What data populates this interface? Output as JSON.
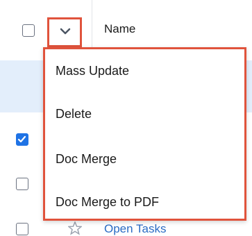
{
  "header": {
    "name_column_label": "Name"
  },
  "mass_actions_menu": {
    "items": [
      "Mass Update",
      "Delete",
      "Doc Merge",
      "Doc Merge to PDF"
    ]
  },
  "rows": [
    {
      "checked": false,
      "highlighted": true
    },
    {
      "checked": true
    },
    {
      "checked": false
    },
    {
      "checked": false,
      "link_text": "Open Tasks"
    }
  ],
  "colors": {
    "highlight_border": "#e0533c",
    "selected_row_bg": "#e3eefb",
    "checkbox_checked": "#1f73e5",
    "link": "#2b6cc4"
  },
  "icons": {
    "toggle": "chevron-down-icon",
    "checked": "checkmark-icon",
    "favorite": "star-icon"
  }
}
